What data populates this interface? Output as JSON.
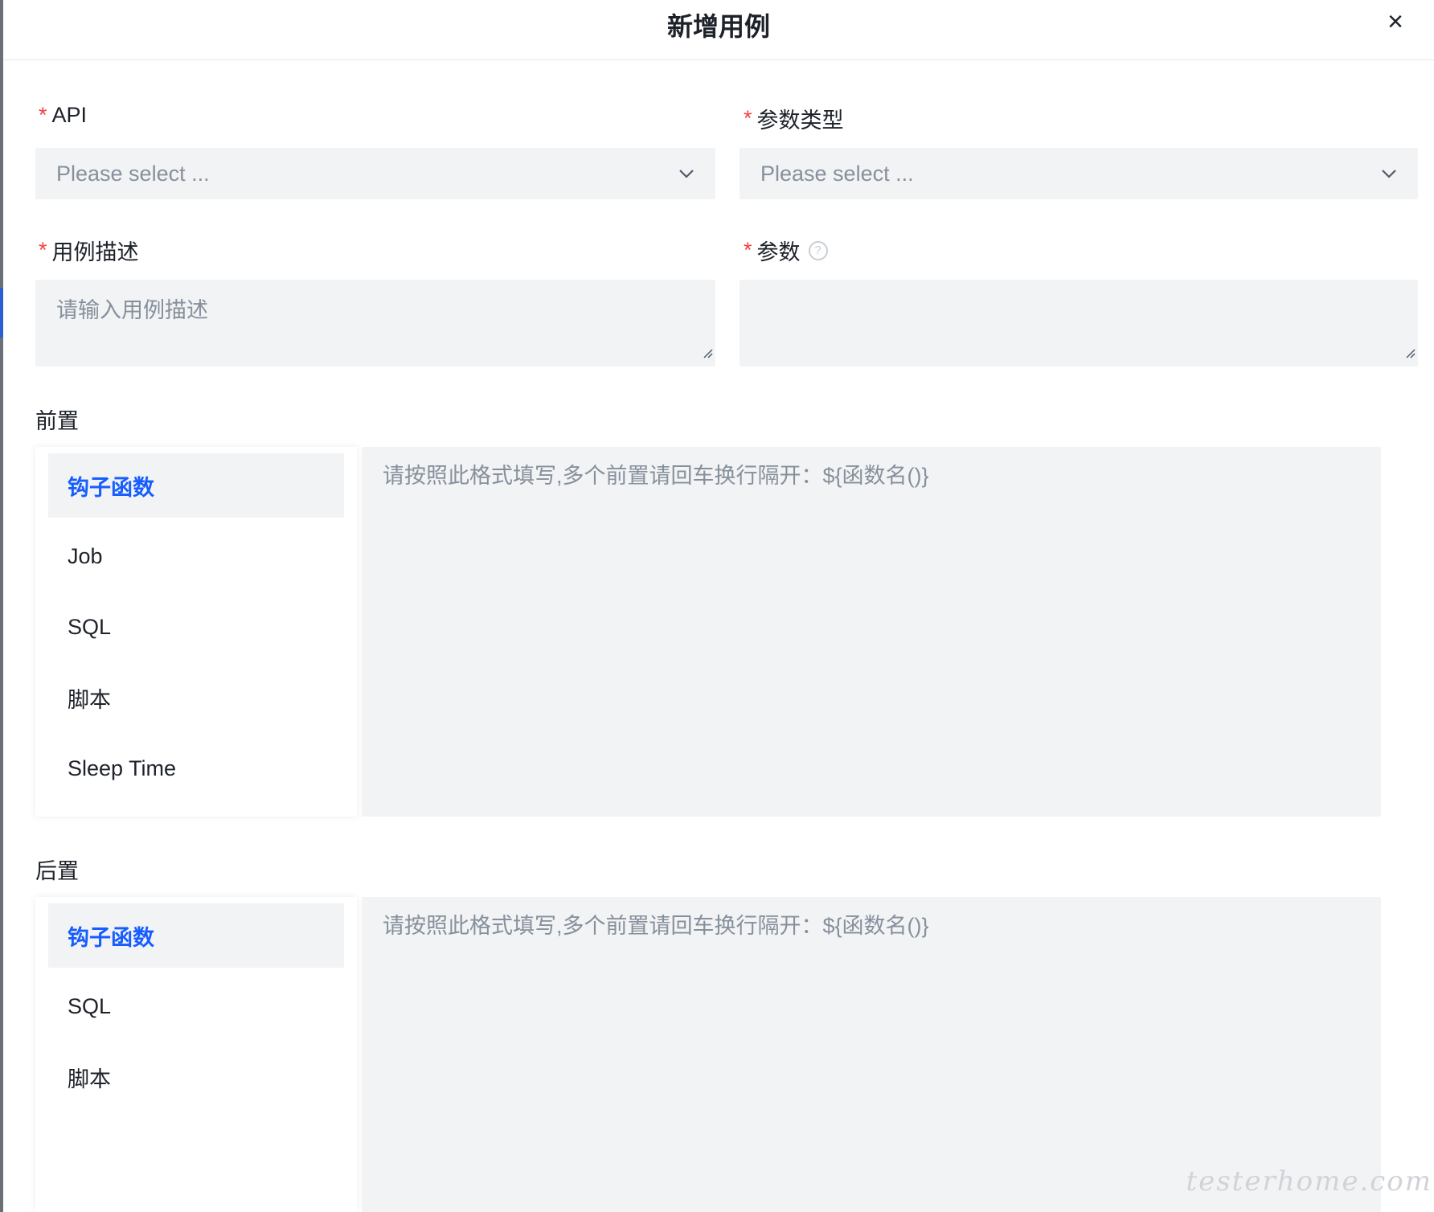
{
  "dialog": {
    "title": "新增用例",
    "close_label": "×"
  },
  "form": {
    "api": {
      "label": "API",
      "placeholder": "Please select ..."
    },
    "param_type": {
      "label": "参数类型",
      "placeholder": "Please select ..."
    },
    "case_desc": {
      "label": "用例描述",
      "placeholder": "请输入用例描述"
    },
    "params": {
      "label": "参数",
      "value": ""
    },
    "required_mark": "*"
  },
  "pre": {
    "title": "前置",
    "tabs": [
      "钩子函数",
      "Job",
      "SQL",
      "脚本",
      "Sleep Time"
    ],
    "active_tab": "钩子函数",
    "placeholder": "请按照此格式填写,多个前置请回车换行隔开：${函数名()}"
  },
  "post": {
    "title": "后置",
    "tabs": [
      "钩子函数",
      "SQL",
      "脚本"
    ],
    "active_tab": "钩子函数",
    "placeholder": "请按照此格式填写,多个前置请回车换行隔开：${函数名()}"
  },
  "watermark": "testerhome.com",
  "colors": {
    "primary": "#165dff",
    "required": "#f53f3f",
    "input_bg": "#f2f3f5",
    "placeholder": "#86909c"
  }
}
